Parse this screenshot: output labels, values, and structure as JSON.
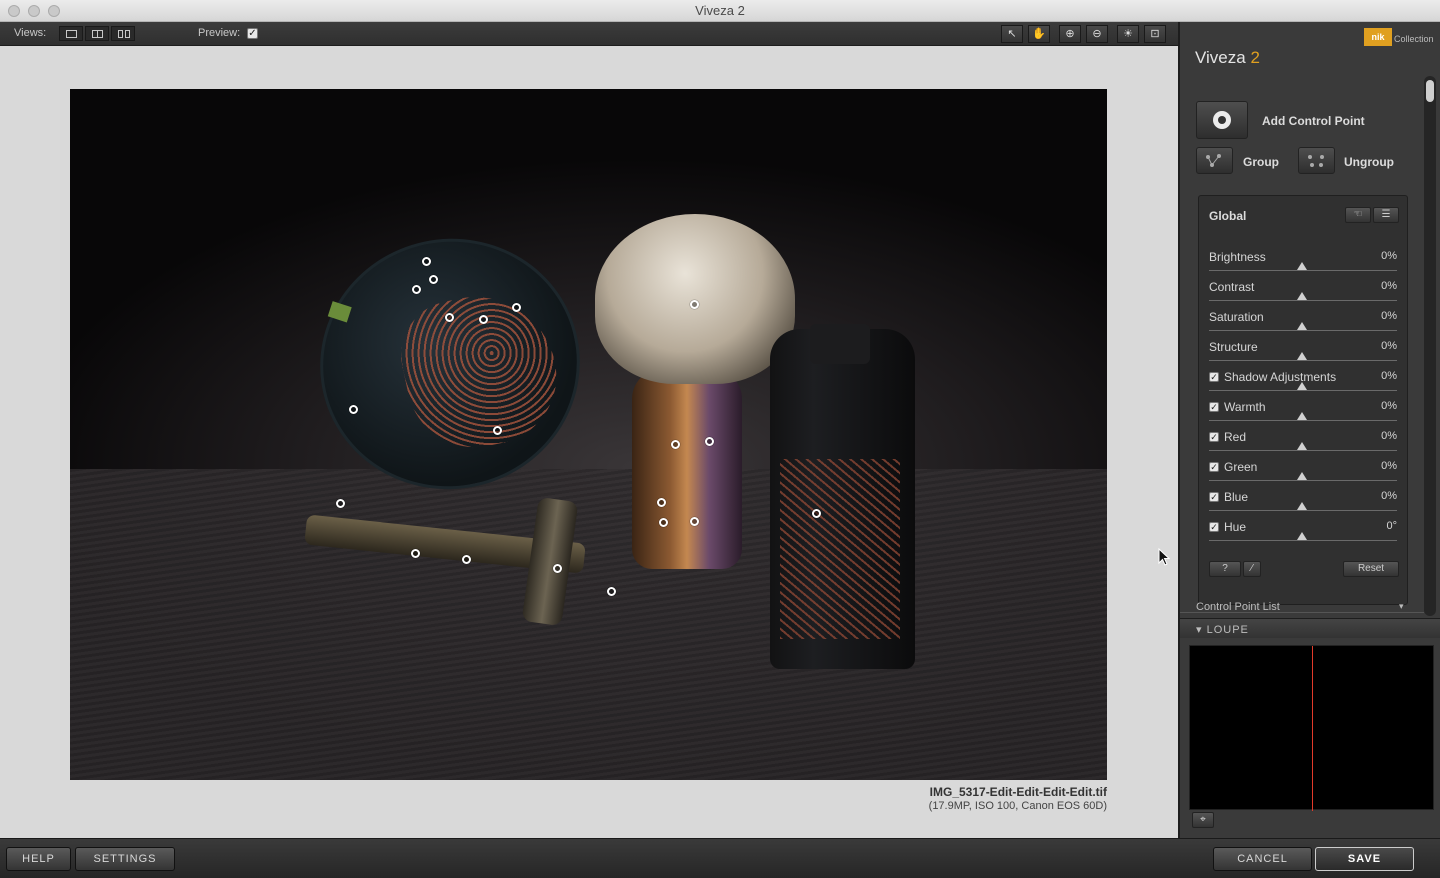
{
  "window": {
    "title": "Viveza 2"
  },
  "toolbar": {
    "views_label": "Views:",
    "preview_label": "Preview:",
    "preview_checked": true
  },
  "image": {
    "filename": "IMG_5317-Edit-Edit-Edit-Edit.tif",
    "meta": "(17.9MP, ISO 100, Canon EOS 60D)"
  },
  "panel": {
    "brand_badge": "nik",
    "brand_collection": "Collection",
    "title": "Viveza",
    "title_version": "2",
    "add_control_point": "Add Control Point",
    "group": "Group",
    "ungroup": "Ungroup",
    "global_label": "Global",
    "sliders": [
      {
        "name": "Brightness",
        "value": "0%",
        "checkbox": false
      },
      {
        "name": "Contrast",
        "value": "0%",
        "checkbox": false
      },
      {
        "name": "Saturation",
        "value": "0%",
        "checkbox": false
      },
      {
        "name": "Structure",
        "value": "0%",
        "checkbox": false
      },
      {
        "name": "Shadow Adjustments",
        "value": "0%",
        "checkbox": true
      },
      {
        "name": "Warmth",
        "value": "0%",
        "checkbox": true
      },
      {
        "name": "Red",
        "value": "0%",
        "checkbox": true
      },
      {
        "name": "Green",
        "value": "0%",
        "checkbox": true
      },
      {
        "name": "Blue",
        "value": "0%",
        "checkbox": true
      },
      {
        "name": "Hue",
        "value": "0°",
        "checkbox": true
      }
    ],
    "help_mini": "?",
    "reset": "Reset",
    "control_point_list": "Control Point List",
    "loupe": "LOUPE"
  },
  "bottom": {
    "help": "HELP",
    "settings": "SETTINGS",
    "cancel": "CANCEL",
    "save": "SAVE"
  }
}
